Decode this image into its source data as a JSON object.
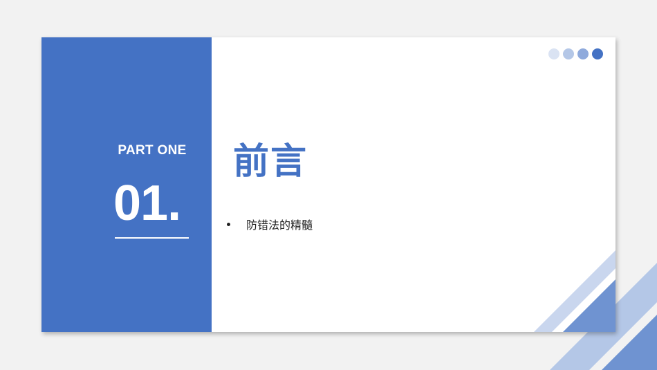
{
  "slide": {
    "part_label": "PART ONE",
    "number": "01.",
    "title": "前言",
    "bullets": [
      "防错法的精髓"
    ]
  },
  "colors": {
    "primary": "#4472c4",
    "dot_1": "#dae3f3",
    "dot_2": "#b4c7e7",
    "dot_3": "#8faadc",
    "dot_4": "#4472c4",
    "stripe_light": "#b4c7e7",
    "stripe_mid": "#6f93d1",
    "background": "#f2f2f2",
    "card": "#ffffff"
  },
  "decor": {
    "dot_icons": [
      "dot-icon",
      "dot-icon",
      "dot-icon",
      "dot-icon"
    ]
  }
}
